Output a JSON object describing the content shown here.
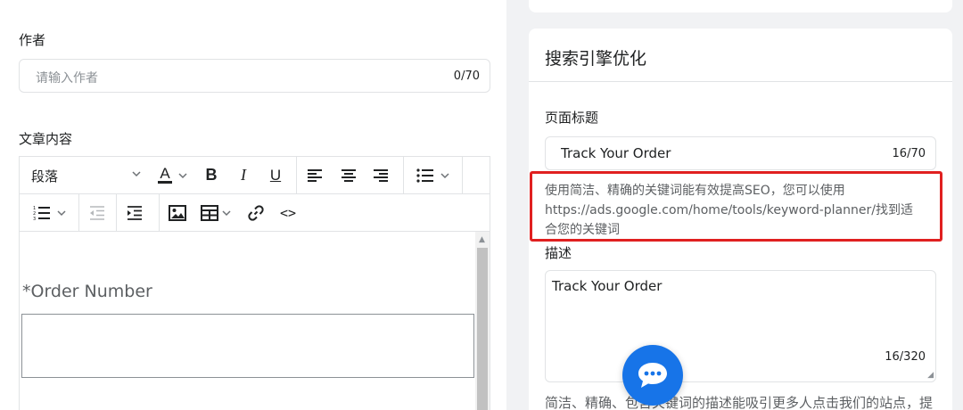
{
  "left": {
    "author": {
      "label": "作者",
      "placeholder": "请输入作者",
      "count": "0/70"
    },
    "content": {
      "label": "文章内容"
    },
    "toolbar": {
      "paragraph": "段落",
      "text_color": "A",
      "bold": "B",
      "italic": "I",
      "underline": "U",
      "code": "<>"
    },
    "editor": {
      "order_label": "*Order Number"
    }
  },
  "right": {
    "seo": {
      "title": "搜索引擎优化",
      "page_title_label": "页面标题",
      "page_title_value": "Track Your Order",
      "page_title_count": "16/70",
      "hint_line1": "使用简洁、精确的关键词能有效提高SEO，您可以使用",
      "hint_line2": "https://ads.google.com/home/tools/keyword-planner/找到适",
      "hint_line3": "合您的关键词",
      "desc_label": "描述",
      "desc_value": "Track Your Order",
      "desc_count": "16/320",
      "desc_hint": "简洁、精确、包含关键词的描述能吸引更多人点击我们的站点，提"
    }
  },
  "colors": {
    "accent": "#1774e8",
    "highlight_border": "#e02020"
  }
}
